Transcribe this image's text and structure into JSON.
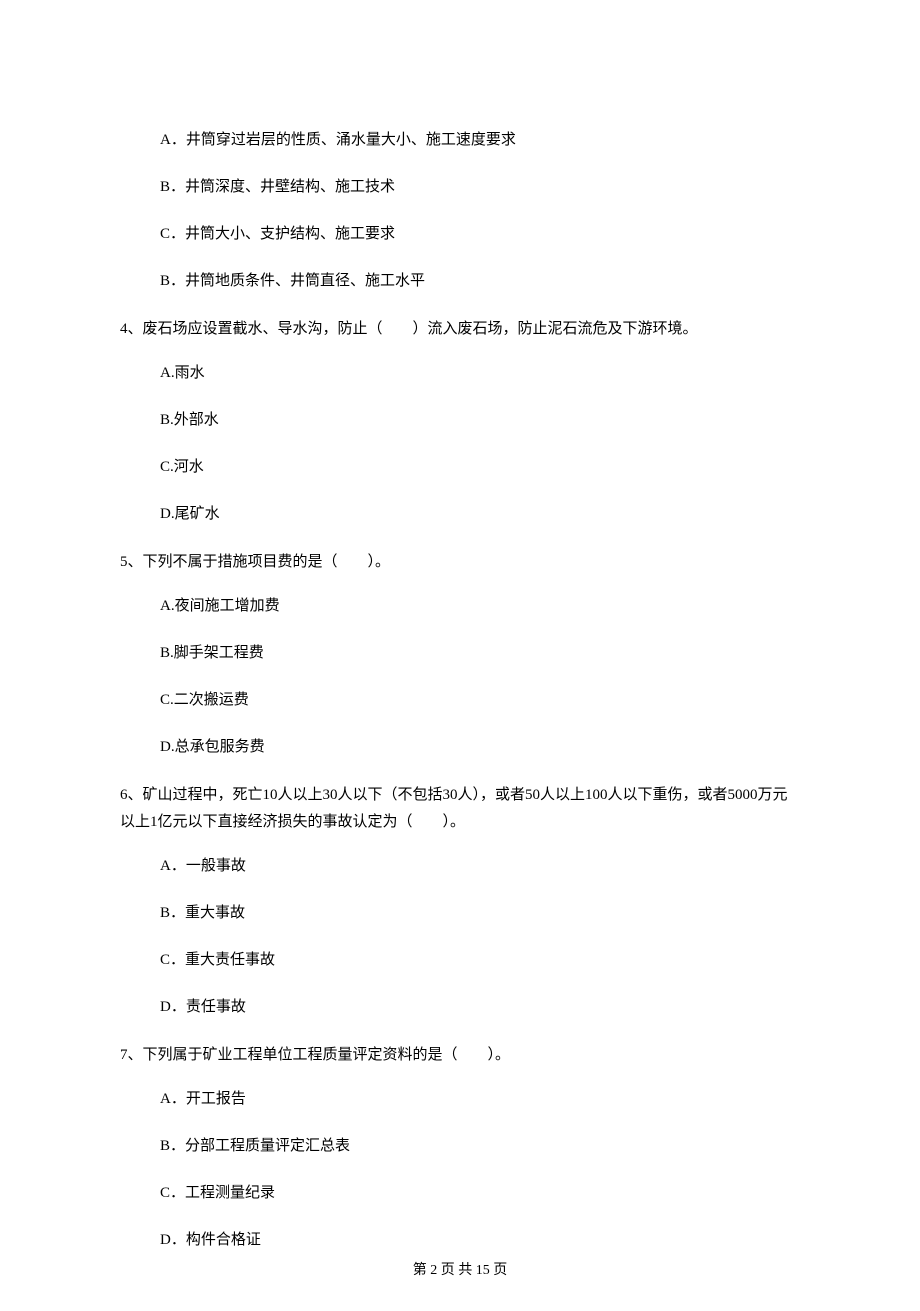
{
  "q3": {
    "optA": "A．井筒穿过岩层的性质、涌水量大小、施工速度要求",
    "optB": "B．井筒深度、井壁结构、施工技术",
    "optC": "C．井筒大小、支护结构、施工要求",
    "optD": "B．井筒地质条件、井筒直径、施工水平"
  },
  "q4": {
    "stem": "4、废石场应设置截水、导水沟，防止（　　）流入废石场，防止泥石流危及下游环境。",
    "optA": "A.雨水",
    "optB": "B.外部水",
    "optC": "C.河水",
    "optD": "D.尾矿水"
  },
  "q5": {
    "stem": "5、下列不属于措施项目费的是（　　）。",
    "optA": "A.夜间施工增加费",
    "optB": "B.脚手架工程费",
    "optC": "C.二次搬运费",
    "optD": "D.总承包服务费"
  },
  "q6": {
    "stem": "6、矿山过程中，死亡10人以上30人以下（不包括30人），或者50人以上100人以下重伤，或者5000万元以上1亿元以下直接经济损失的事故认定为（　　）。",
    "optA": "A．一般事故",
    "optB": "B．重大事故",
    "optC": "C．重大责任事故",
    "optD": "D．责任事故"
  },
  "q7": {
    "stem": "7、下列属于矿业工程单位工程质量评定资料的是（　　）。",
    "optA": "A．开工报告",
    "optB": "B．分部工程质量评定汇总表",
    "optC": "C．工程测量纪录",
    "optD": "D．构件合格证"
  },
  "footer": "第 2 页 共 15 页"
}
